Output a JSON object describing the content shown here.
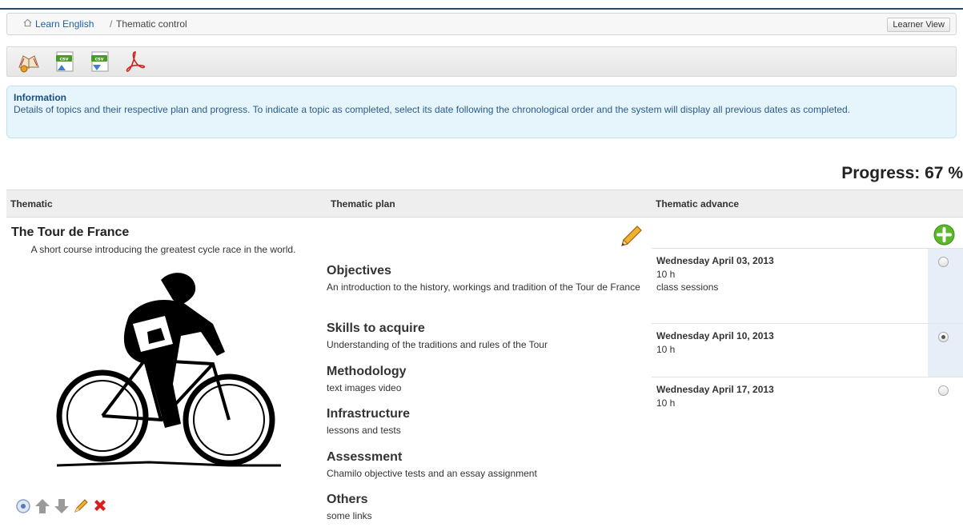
{
  "breadcrumb": {
    "home_link": "Learn English",
    "separator": "/",
    "current": "Thematic control"
  },
  "header": {
    "learner_view_button": "Learner View"
  },
  "toolbar": {
    "icons": [
      "course-settings-icon",
      "csv-import-icon",
      "csv-export-icon",
      "pdf-export-icon"
    ]
  },
  "info": {
    "title": "Information",
    "text": "Details of topics and their respective plan and progress. To indicate a topic as completed, select its date following the chronological order and the system will display all previous dates as completed."
  },
  "progress": {
    "label": "Progress: 67 %",
    "value": 67
  },
  "table": {
    "columns": [
      "Thematic",
      "Thematic plan",
      "Thematic advance"
    ]
  },
  "thematic": {
    "title": "The Tour de France",
    "description": "A short course introducing the greatest cycle race in the world.",
    "image_icon": "cyclist-image",
    "actions": [
      "view-icon",
      "move-up-icon",
      "move-down-icon",
      "edit-icon",
      "delete-icon"
    ]
  },
  "plan": {
    "sections": [
      {
        "heading": "Objectives",
        "text": "An introduction to the history, workings and tradition of the Tour de France"
      },
      {
        "heading": "Skills to acquire",
        "text": " Understanding of the traditions and rules of the Tour"
      },
      {
        "heading": "Methodology",
        "text": "text images video"
      },
      {
        "heading": "Infrastructure",
        "text": " lessons and tests"
      },
      {
        "heading": "Assessment",
        "text": " Chamilo objective tests and an essay assignment"
      },
      {
        "heading": "Others",
        "text": " some links"
      }
    ]
  },
  "advance": {
    "rows": [
      {
        "date": "Wednesday April 03, 2013",
        "duration": "10 h",
        "note": " class sessions",
        "selected": false
      },
      {
        "date": "Wednesday April 10, 2013",
        "duration": "10 h",
        "note": "",
        "selected": true
      },
      {
        "date": "Wednesday April 17, 2013",
        "duration": "10 h",
        "note": "",
        "selected": false
      }
    ],
    "highlight_color": "#e8eef7"
  },
  "colors": {
    "link": "#1f5fa5",
    "info_bg": "#e6f4fb",
    "info_text": "#2a5b8c",
    "add_green": "#5cb82a"
  }
}
